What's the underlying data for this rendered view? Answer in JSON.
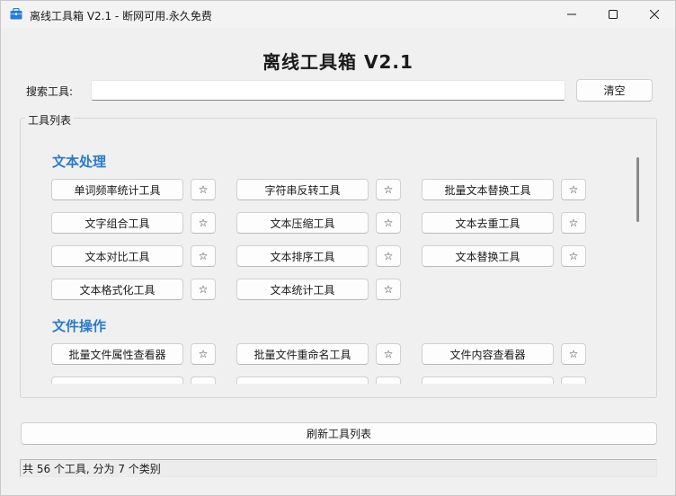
{
  "window": {
    "title": "离线工具箱 V2.1 - 断网可用.永久免费",
    "icon": "toolbox-icon",
    "minimize": "minimize-icon",
    "maximize": "maximize-icon",
    "close": "close-icon"
  },
  "heading": "离线工具箱 V2.1",
  "search": {
    "label": "搜索工具:",
    "value": "",
    "placeholder": "",
    "clear_label": "清空"
  },
  "group_title": "工具列表",
  "categories": [
    {
      "name": "文本处理",
      "tools": [
        "单词频率统计工具",
        "字符串反转工具",
        "批量文本替换工具",
        "文字组合工具",
        "文本压缩工具",
        "文本去重工具",
        "文本对比工具",
        "文本排序工具",
        "文本替换工具",
        "文本格式化工具",
        "文本统计工具"
      ]
    },
    {
      "name": "文件操作",
      "tools": [
        "批量文件属性查看器",
        "批量文件重命名工具",
        "文件内容查看器"
      ]
    }
  ],
  "star_label": "☆",
  "refresh_label": "刷新工具列表",
  "status": "共 56 个工具, 分为 7 个类别",
  "colors": {
    "category": "#2a7ac7",
    "accent": "#1a6fc9"
  }
}
